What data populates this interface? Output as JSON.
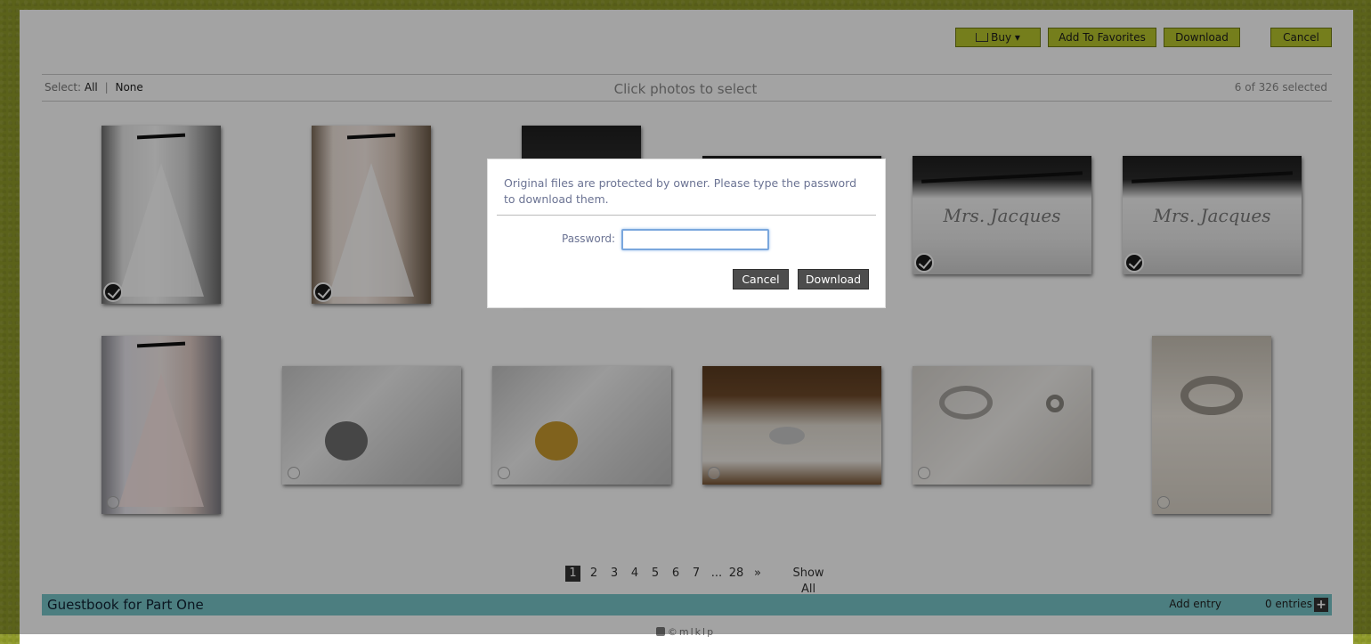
{
  "toolbar": {
    "buy_label": "Buy ▾",
    "favorites_label": "Add To Favorites",
    "download_label": "Download",
    "cancel_label": "Cancel"
  },
  "selection": {
    "select_label": "Select:",
    "all_label": "All",
    "separator": "|",
    "none_label": "None",
    "hint": "Click photos to select",
    "count": "6 of 326 selected"
  },
  "photos": [
    {
      "kind": "dress-bw",
      "selected": true
    },
    {
      "kind": "dress-color",
      "selected": true
    },
    {
      "kind": "hanger-partial",
      "selected": true
    },
    {
      "kind": "hanger-partial",
      "selected": true
    },
    {
      "kind": "hanger",
      "script": "Mrs. Jacques",
      "selected": true
    },
    {
      "kind": "hanger",
      "script": "Mrs. Jacques",
      "selected": true
    },
    {
      "kind": "dress-back",
      "selected": false
    },
    {
      "kind": "garter-gray",
      "selected": false
    },
    {
      "kind": "garter-gold",
      "selected": false
    },
    {
      "kind": "jewelry-wood",
      "selected": false
    },
    {
      "kind": "jewelry-lace",
      "selected": false
    },
    {
      "kind": "ring",
      "selected": false
    }
  ],
  "pagination": {
    "pages": [
      "1",
      "2",
      "3",
      "4",
      "5",
      "6",
      "7",
      "...",
      "28",
      "»"
    ],
    "current": "1",
    "show_all_label": "Show All"
  },
  "guestbook": {
    "title": "Guestbook for Part One",
    "add_entry_label": "Add entry",
    "entries_count": "0 entries",
    "plus_label": "+"
  },
  "footer": {
    "text": "©mlklp"
  },
  "modal": {
    "message": "Original files are protected by owner. Please type the password to download them.",
    "password_label": "Password:",
    "password_value": "",
    "cancel_label": "Cancel",
    "download_label": "Download"
  },
  "colors": {
    "background": "#8f9a2a",
    "toolbar_button": "#b7c62c",
    "guestbook_bar": "#77c6c8",
    "modal_button": "#4d4d4d",
    "modal_text": "#6b7393"
  }
}
